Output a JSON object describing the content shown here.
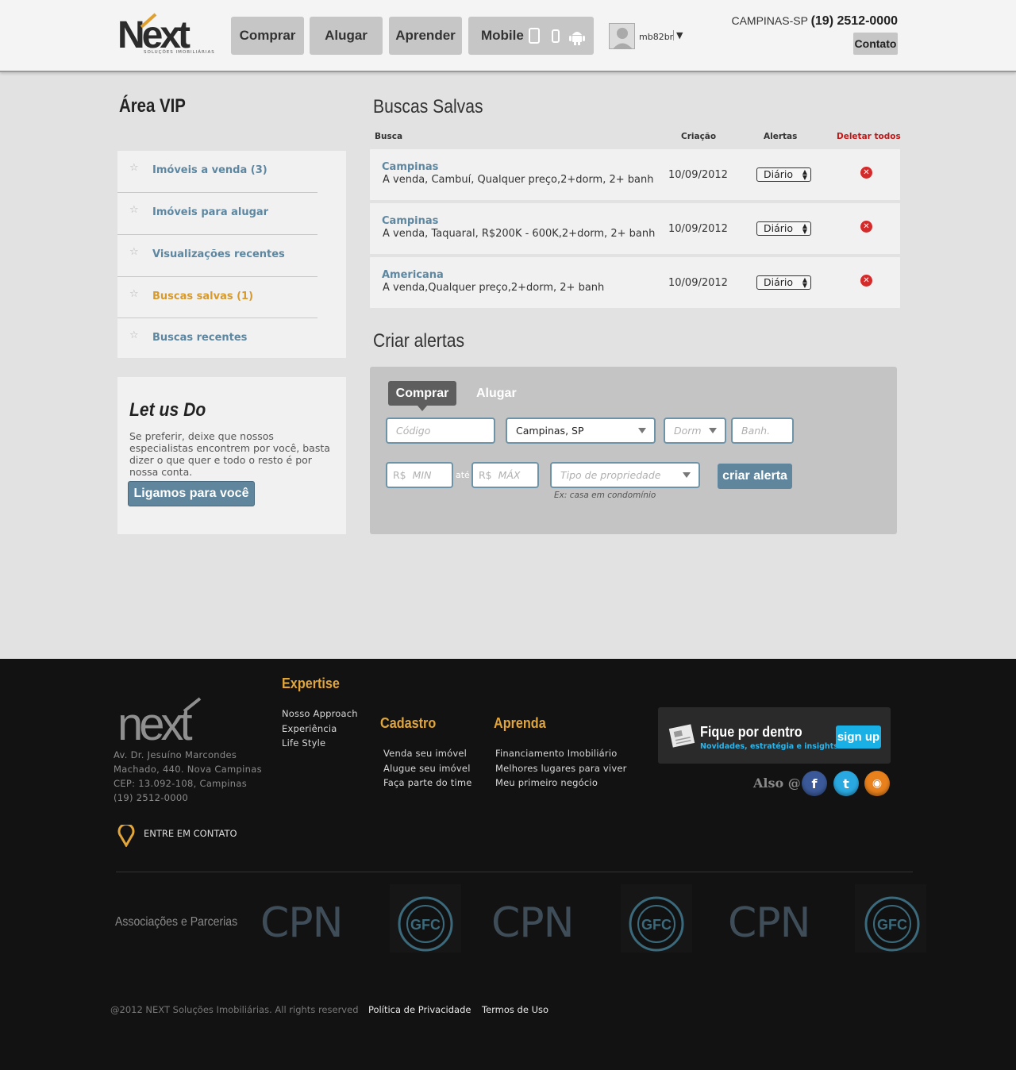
{
  "header": {
    "logo_text": "Next",
    "logo_tagline": "SOLUÇÕES IMOBILIÁRIAS",
    "nav": [
      "Comprar",
      "Alugar",
      "Aprender",
      "Mobile"
    ],
    "mobile_icons": [
      "tablet-icon",
      "phone-icon",
      "android-icon"
    ],
    "user": {
      "name": "mb82br",
      "caret": "▼"
    },
    "city": "CAMPINAS-SP",
    "phone": "(19) 2512-0000",
    "contact_button": "Contato"
  },
  "sidebar": {
    "title": "Área VIP",
    "items": [
      {
        "label": "Imóveis a venda (3)",
        "active": false
      },
      {
        "label": "Imóveis para alugar",
        "active": false
      },
      {
        "label": "Visualizações recentes",
        "active": false
      },
      {
        "label": "Buscas salvas (1)",
        "active": true
      },
      {
        "label": "Buscas recentes",
        "active": false
      }
    ]
  },
  "letus": {
    "title": "Let us Do",
    "text": "Se preferir, deixe que nossos especialistas encontrem por você, basta dizer o que quer e todo o resto é por nossa conta.",
    "button": "Ligamos para você"
  },
  "saved_searches": {
    "title": "Buscas Salvas",
    "columns": {
      "search": "Busca",
      "created": "Criação",
      "alerts": "Alertas",
      "delete_all": "Deletar todos"
    },
    "rows": [
      {
        "city": "Campinas",
        "desc": "A venda, Cambuí, Qualquer preço,2+dorm, 2+ banh",
        "date": "10/09/2012",
        "alert": "Diário"
      },
      {
        "city": "Campinas",
        "desc": "A venda, Taquaral, R$200K - 600K,2+dorm, 2+ banh",
        "date": "10/09/2012",
        "alert": "Diário"
      },
      {
        "city": "Americana",
        "desc": "A venda,Qualquer preço,2+dorm, 2+ banh",
        "date": "10/09/2012",
        "alert": "Diário"
      }
    ]
  },
  "create_alert": {
    "title": "Criar alertas",
    "tabs": [
      "Comprar",
      "Alugar"
    ],
    "code_placeholder": "Código",
    "city_value": "Campinas, SP",
    "dorm_placeholder": "Dorm",
    "bath_placeholder": "Banh.",
    "currency": "R$",
    "min_placeholder": "MIN",
    "to_label": "até",
    "max_placeholder": "MÁX",
    "type_placeholder": "Tipo de propriedade",
    "type_hint": "Ex: casa em condomínio",
    "submit": "criar alerta"
  },
  "footer": {
    "logo_text": "Next",
    "address": [
      "Av. Dr. Jesuíno Marcondes",
      "Machado, 440. Nova Campinas",
      "CEP: 13.092-108, Campinas",
      "(19) 2512-0000"
    ],
    "contact": "ENTRE EM CONTATO",
    "columns": [
      {
        "title": "Expertise",
        "links": [
          "Nosso Approach",
          "Experiência",
          "Life Style"
        ]
      },
      {
        "title": "Cadastro",
        "links": [
          "Venda seu imóvel",
          "Alugue seu imóvel",
          "Faça parte do time"
        ]
      },
      {
        "title": "Aprenda",
        "links": [
          "Financiamento Imobiliário",
          "Melhores lugares para viver",
          "Meu primeiro negócio"
        ]
      }
    ],
    "newsletter": {
      "title": "Fique por dentro",
      "subtitle": "Novidades, estratégia e insights",
      "button": "sign up"
    },
    "also": "Also @",
    "social": [
      {
        "name": "facebook-icon",
        "glyph": "f",
        "color": "#3b5998"
      },
      {
        "name": "twitter-icon",
        "glyph": "t",
        "color": "#2aa9e0"
      },
      {
        "name": "rss-icon",
        "glyph": "◉",
        "color": "#e8801c"
      }
    ],
    "partners_label": "Associações e Parcerias",
    "partners": [
      "CPN",
      "GFC",
      "CPN",
      "GFC",
      "CPN",
      "GFC"
    ],
    "copyright": "@2012 NEXT Soluções Imobiliárias. All rights reserved",
    "privacy": "Política de Privacidade",
    "terms": "Termos de Uso"
  }
}
